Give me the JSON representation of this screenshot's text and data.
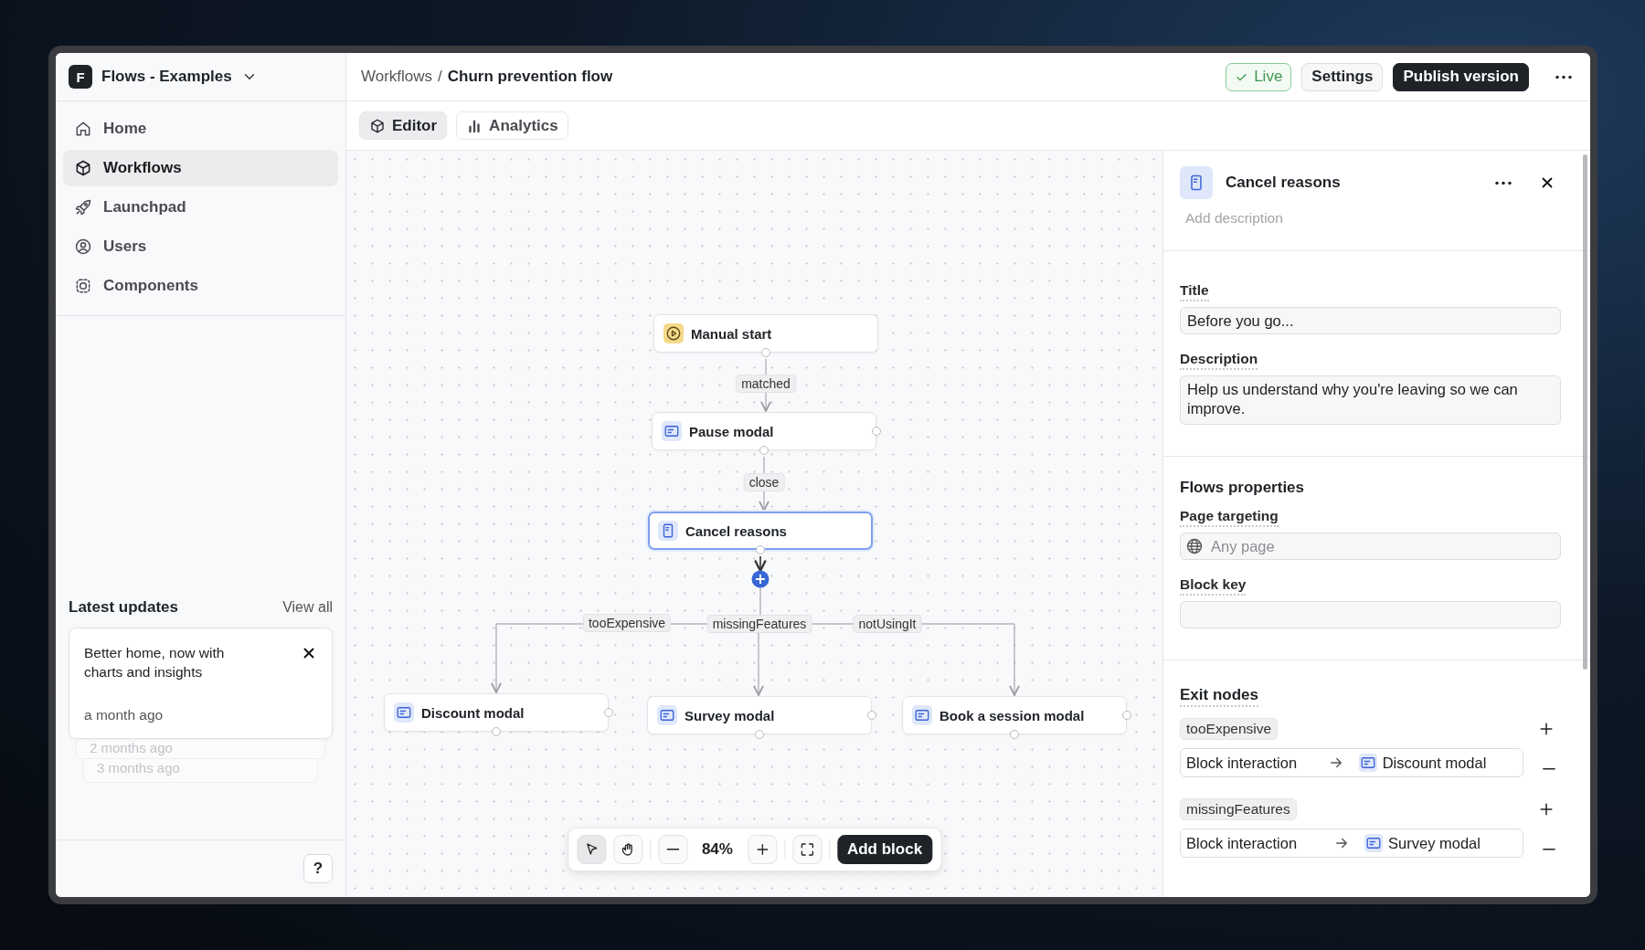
{
  "workspace": {
    "initial": "F",
    "name": "Flows - Examples"
  },
  "sidebar": {
    "items": [
      {
        "label": "Home",
        "selected": false
      },
      {
        "label": "Workflows",
        "selected": true
      },
      {
        "label": "Launchpad",
        "selected": false
      },
      {
        "label": "Users",
        "selected": false
      },
      {
        "label": "Components",
        "selected": false
      }
    ]
  },
  "latest_updates": {
    "title": "Latest updates",
    "link": "View all",
    "card": {
      "text": "Better home, now with charts and insights",
      "time": "a month ago"
    },
    "stacked": [
      {
        "time": "2 months ago"
      },
      {
        "time": "3 months ago"
      }
    ]
  },
  "help_button": "?",
  "breadcrumb": {
    "parent": "Workflows",
    "separator": "/",
    "current": "Churn prevention flow"
  },
  "header": {
    "status": "Live",
    "settings": "Settings",
    "publish": "Publish version"
  },
  "tabs": [
    {
      "label": "Editor",
      "selected": true
    },
    {
      "label": "Analytics",
      "selected": false
    }
  ],
  "canvas": {
    "nodes": [
      {
        "kind": "trigger",
        "label": "Manual start",
        "selected": false
      },
      {
        "kind": "modal",
        "label": "Pause modal",
        "selected": false
      },
      {
        "kind": "form",
        "label": "Cancel reasons",
        "selected": true
      },
      {
        "kind": "modal",
        "label": "Discount modal",
        "selected": false
      },
      {
        "kind": "modal",
        "label": "Survey modal",
        "selected": false
      },
      {
        "kind": "modal",
        "label": "Book a session modal",
        "selected": false
      }
    ],
    "edges": [
      {
        "label": "matched"
      },
      {
        "label": "close"
      },
      {
        "label": "tooExpensive"
      },
      {
        "label": "missingFeatures"
      },
      {
        "label": "notUsingIt"
      }
    ],
    "toolbar": {
      "tools": [
        {
          "selected": true
        },
        {
          "selected": false
        }
      ],
      "zoom": "84%",
      "add_button": "Add block"
    }
  },
  "panel": {
    "title": "Cancel reasons",
    "description_placeholder": "Add description",
    "fields": [
      {
        "label": "Title",
        "value": "Before you go...",
        "multiline": false
      },
      {
        "label": "Description",
        "value": "Help us understand why you're leaving so we can improve.",
        "multiline": true
      }
    ],
    "properties_title": "Flows properties",
    "properties": [
      {
        "kind": "page",
        "label": "Page targeting",
        "placeholder": "Any page"
      },
      {
        "kind": "text",
        "label": "Block key"
      }
    ],
    "exit_title": "Exit nodes",
    "exits": [
      {
        "key": "tooExpensive",
        "source": "Block interaction",
        "target": "Discount modal"
      },
      {
        "key": "missingFeatures",
        "source": "Block interaction",
        "target": "Survey modal"
      }
    ]
  }
}
